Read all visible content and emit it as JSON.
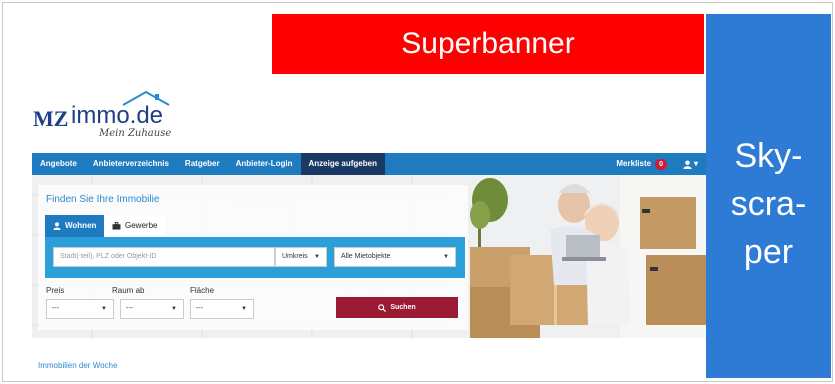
{
  "banners": {
    "superbanner": "Superbanner",
    "skyscraper_lines": [
      "Sky-",
      "scra-",
      "per"
    ]
  },
  "logo": {
    "brand_mz": "MZ",
    "brand_immo": "immo.de",
    "tagline": "Mein Zuhause"
  },
  "nav": {
    "items": [
      "Angebote",
      "Anbieterverzeichnis",
      "Ratgeber",
      "Anbieter-Login",
      "Anzeige aufgeben"
    ],
    "merkliste": "Merkliste",
    "merkliste_count": "0",
    "user_caret": "▾"
  },
  "search": {
    "title": "Finden Sie Ihre Immobilie",
    "tab_wohnen": "Wohnen",
    "tab_gewerbe": "Gewerbe",
    "location_placeholder": "Stadt(-teil), PLZ oder Objekt-ID",
    "umkreis": "Umkreis",
    "object_type": "Alle Mietobjekte",
    "labels": {
      "preis": "Preis",
      "raum": "Raum ab",
      "flaeche": "Fläche"
    },
    "select_value": "---",
    "submit": "Suchen"
  },
  "section": {
    "immobilien_der_woche": "Immobilien der Woche"
  },
  "colors": {
    "superbanner": "#ff0000",
    "skyscraper": "#2e7bd6",
    "navbar": "#1f7bc0",
    "nav_active": "#1a3a63",
    "search_bar": "#2a9fd8",
    "submit": "#9b1b35",
    "badge": "#cc1e36"
  }
}
